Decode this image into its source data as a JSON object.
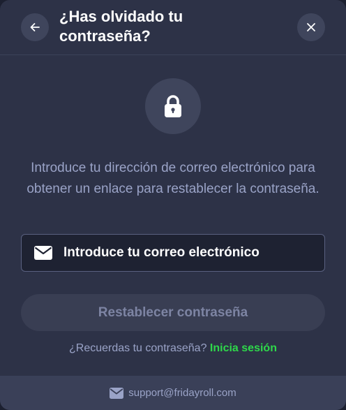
{
  "dialog": {
    "title": "¿Has olvidado tu contraseña?",
    "back_icon": "arrow-left-icon",
    "close_icon": "close-icon",
    "lock_icon": "lock-icon",
    "description": "Introduce tu dirección de correo electrónico para obtener un enlace para restablecer la contraseña.",
    "email_field": {
      "placeholder": "Introduce tu correo electrónico",
      "value": "",
      "icon": "envelope-icon"
    },
    "reset_button_label": "Restablecer contraseña",
    "remember_text": "¿Recuerdas tu contraseña?",
    "login_link_label": "Inicia sesión",
    "support_email": "support@fridayroll.com",
    "support_icon": "envelope-icon"
  },
  "colors": {
    "background": "#2d3247",
    "login_link": "#2ed84a",
    "muted_text": "#9aa3c7",
    "button_disabled": "#393e53"
  }
}
